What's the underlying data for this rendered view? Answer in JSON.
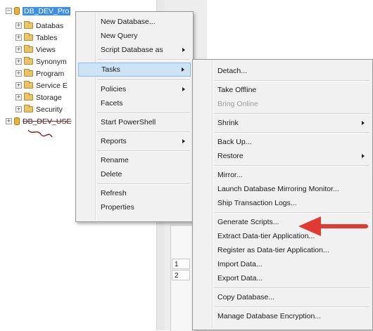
{
  "tree": {
    "root": "DB_DEV_Pro",
    "children": [
      "Databas",
      "Tables",
      "Views",
      "Synonym",
      "Program",
      "Service E",
      "Storage",
      "Security"
    ],
    "second_root": "DB_DEV_USE"
  },
  "context_menu": {
    "items": [
      {
        "label": "New Database..."
      },
      {
        "label": "New Query"
      },
      {
        "label": "Script Database as"
      },
      {
        "label": "Tasks"
      },
      {
        "label": "Policies"
      },
      {
        "label": "Facets"
      },
      {
        "label": "Start PowerShell"
      },
      {
        "label": "Reports"
      },
      {
        "label": "Rename"
      },
      {
        "label": "Delete"
      },
      {
        "label": "Refresh"
      },
      {
        "label": "Properties"
      }
    ]
  },
  "tasks_submenu": {
    "items": [
      {
        "label": "Detach..."
      },
      {
        "label": "Take Offline"
      },
      {
        "label": "Bring Online"
      },
      {
        "label": "Shrink"
      },
      {
        "label": "Back Up..."
      },
      {
        "label": "Restore"
      },
      {
        "label": "Mirror..."
      },
      {
        "label": "Launch Database Mirroring Monitor..."
      },
      {
        "label": "Ship Transaction Logs..."
      },
      {
        "label": "Generate Scripts..."
      },
      {
        "label": "Extract Data-tier Application..."
      },
      {
        "label": "Register as Data-tier Application..."
      },
      {
        "label": "Import Data..."
      },
      {
        "label": "Export Data..."
      },
      {
        "label": "Copy Database..."
      },
      {
        "label": "Manage Database Encryption..."
      }
    ]
  },
  "grid": {
    "rows": [
      "1",
      "2"
    ]
  },
  "colors": {
    "selection": "#3d8ee8",
    "highlight": "#cde4f7",
    "annotation": "#e03a32"
  }
}
